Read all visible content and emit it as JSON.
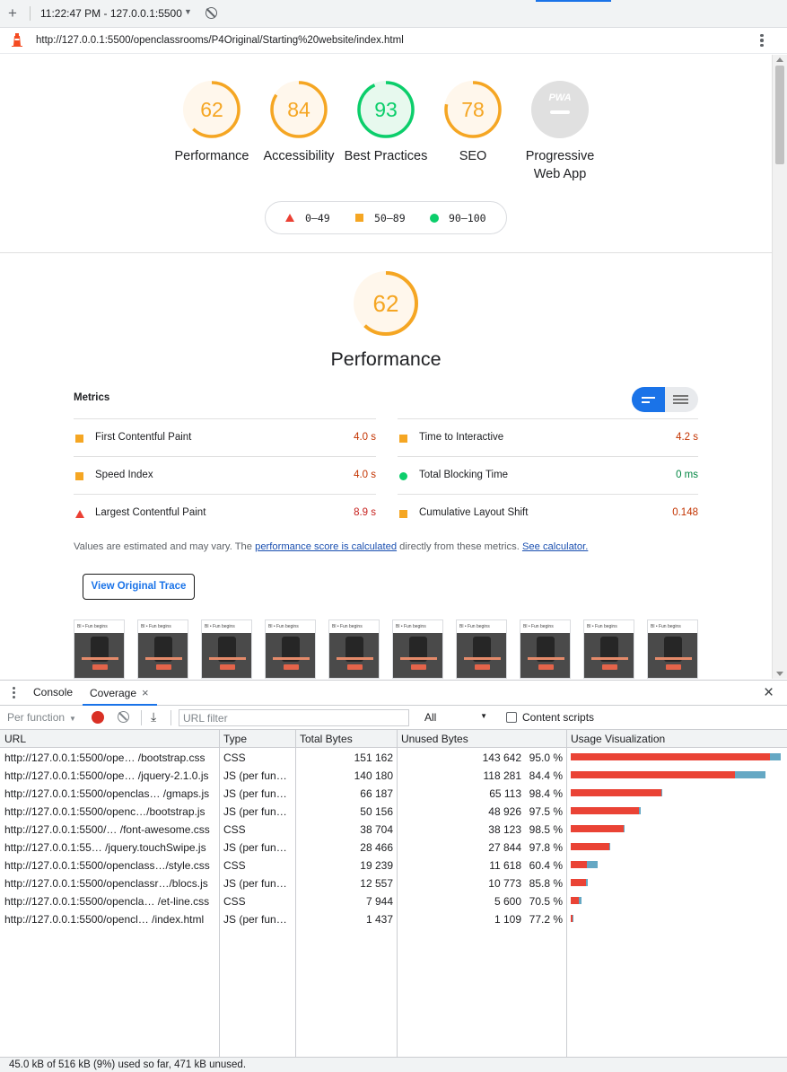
{
  "topbar": {
    "plus": "+",
    "session": "11:22:47 PM - 127.0.0.1:5500",
    "caret": "▼"
  },
  "address": {
    "url": "http://127.0.0.1:5500/openclassrooms/P4Original/Starting%20website/index.html"
  },
  "gauges": [
    {
      "score": "62",
      "label": "Performance",
      "fraction": 0.62,
      "color": "#f5a623"
    },
    {
      "score": "84",
      "label": "Accessibility",
      "fraction": 0.84,
      "color": "#f5a623"
    },
    {
      "score": "93",
      "label": "Best Practices",
      "fraction": 0.93,
      "color": "#0cce6b"
    },
    {
      "score": "78",
      "label": "SEO",
      "fraction": 0.78,
      "color": "#f5a623"
    }
  ],
  "pwa": {
    "badge": "PWA",
    "label": "Progressive Web App"
  },
  "legend": {
    "fail": "0–49",
    "average": "50–89",
    "pass": "90–100"
  },
  "performance": {
    "score": "62",
    "fraction": 0.62,
    "title": "Performance",
    "metrics_heading": "Metrics",
    "metrics": [
      {
        "name": "First Contentful Paint",
        "value": "4.0 s",
        "rating": "average"
      },
      {
        "name": "Time to Interactive",
        "value": "4.2 s",
        "rating": "average"
      },
      {
        "name": "Speed Index",
        "value": "4.0 s",
        "rating": "average"
      },
      {
        "name": "Total Blocking Time",
        "value": "0 ms",
        "rating": "pass"
      },
      {
        "name": "Largest Contentful Paint",
        "value": "8.9 s",
        "rating": "fail"
      },
      {
        "name": "Cumulative Layout Shift",
        "value": "0.148",
        "rating": "average"
      }
    ],
    "note_prefix": "Values are estimated and may vary. The ",
    "note_link1": "performance score is calculated",
    "note_middle": " directly from these metrics. ",
    "note_link2": "See calculator.",
    "trace_button": "View Original Trace",
    "thumb_header": "Bl • Fun begins",
    "thumb_count": 10
  },
  "colors": {
    "fail": "#eb4034",
    "average": "#f5a623",
    "pass": "#0cce6b",
    "accent": "#1a73e8",
    "used": "#ea4335",
    "unused": "#65a8c4"
  },
  "devtools": {
    "tabs": [
      {
        "label": "Console"
      },
      {
        "label": "Coverage",
        "close": "×"
      }
    ],
    "close": "×",
    "toolbar": {
      "per_function": "Per function",
      "filter_placeholder": "URL filter",
      "type_select": "All",
      "content_scripts": "Content scripts"
    },
    "columns": [
      "URL",
      "Type",
      "Total Bytes",
      "Unused Bytes",
      "Usage Visualization"
    ],
    "rows": [
      {
        "url": "http://127.0.0.1:5500/ope… /bootstrap.css",
        "type": "CSS",
        "total": "151 162",
        "unused": "143 642",
        "pct": "95.0 %",
        "total_n": 151162,
        "unused_n": 143642
      },
      {
        "url": "http://127.0.0.1:5500/ope… /jquery-2.1.0.js",
        "type": "JS (per fun…",
        "total": "140 180",
        "unused": "118 281",
        "pct": "84.4 %",
        "total_n": 140180,
        "unused_n": 118281
      },
      {
        "url": "http://127.0.0.1:5500/openclas… /gmaps.js",
        "type": "JS (per fun…",
        "total": "66 187",
        "unused": "65 113",
        "pct": "98.4 %",
        "total_n": 66187,
        "unused_n": 65113
      },
      {
        "url": "http://127.0.0.1:5500/openc…/bootstrap.js",
        "type": "JS (per fun…",
        "total": "50 156",
        "unused": "48 926",
        "pct": "97.5 %",
        "total_n": 50156,
        "unused_n": 48926
      },
      {
        "url": "http://127.0.0.1:5500/… /font-awesome.css",
        "type": "CSS",
        "total": "38 704",
        "unused": "38 123",
        "pct": "98.5 %",
        "total_n": 38704,
        "unused_n": 38123
      },
      {
        "url": "http://127.0.0.1:55… /jquery.touchSwipe.js",
        "type": "JS (per fun…",
        "total": "28 466",
        "unused": "27 844",
        "pct": "97.8 %",
        "total_n": 28466,
        "unused_n": 27844
      },
      {
        "url": "http://127.0.0.1:5500/openclass…/style.css",
        "type": "CSS",
        "total": "19 239",
        "unused": "11 618",
        "pct": "60.4 %",
        "total_n": 19239,
        "unused_n": 11618
      },
      {
        "url": "http://127.0.0.1:5500/openclassr…/blocs.js",
        "type": "JS (per fun…",
        "total": "12 557",
        "unused": "10 773",
        "pct": "85.8 %",
        "total_n": 12557,
        "unused_n": 10773
      },
      {
        "url": "http://127.0.0.1:5500/opencla… /et-line.css",
        "type": "CSS",
        "total": "7 944",
        "unused": "5 600",
        "pct": "70.5 %",
        "total_n": 7944,
        "unused_n": 5600
      },
      {
        "url": "http://127.0.0.1:5500/opencl… /index.html",
        "type": "JS (per fun…",
        "total": "1 437",
        "unused": "1 109",
        "pct": "77.2 %",
        "total_n": 1437,
        "unused_n": 1109
      }
    ],
    "status": "45.0 kB of 516 kB (9%) used so far, 471 kB unused."
  }
}
